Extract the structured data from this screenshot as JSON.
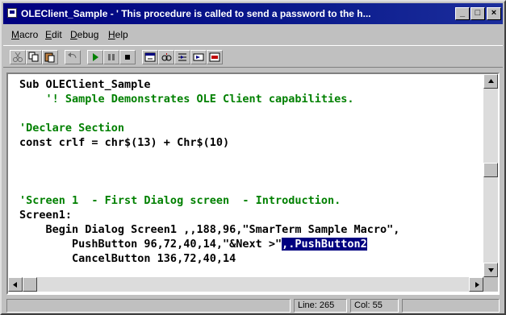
{
  "window": {
    "title": "OLEClient_Sample - ' This procedure is called to send a password to the h..."
  },
  "title_buttons": {
    "minimize": "_",
    "maximize": "□",
    "close": "×"
  },
  "menu": [
    {
      "first": "M",
      "rest": "acro"
    },
    {
      "first": "E",
      "rest": "dit"
    },
    {
      "first": "D",
      "rest": "ebug"
    },
    {
      "first": "H",
      "rest": "elp"
    }
  ],
  "toolbar": {
    "tools": [
      "cut-icon",
      "copy-icon",
      "paste-icon",
      "undo-icon",
      "run-icon",
      "pause-icon",
      "stop-icon",
      "dialog-editor-icon",
      "watch-icon",
      "step-into-icon",
      "step-over-icon",
      "toggle-breakpoint-icon"
    ]
  },
  "code": {
    "lines": [
      [
        {
          "t": "Sub OLEClient_Sample",
          "c": "kw"
        }
      ],
      [
        {
          "t": "    '! Sample Demonstrates OLE Client capabilities.",
          "c": "cm"
        }
      ],
      [
        {
          "t": "",
          "c": "kw"
        }
      ],
      [
        {
          "t": "'Declare Section",
          "c": "cm"
        }
      ],
      [
        {
          "t": "const crlf = chr$(13) + Chr$(10)",
          "c": "kw"
        }
      ],
      [
        {
          "t": "",
          "c": "kw"
        }
      ],
      [
        {
          "t": "",
          "c": "kw"
        }
      ],
      [
        {
          "t": "",
          "c": "kw"
        }
      ],
      [
        {
          "t": "'Screen 1  - First Dialog screen  - Introduction.",
          "c": "cm"
        }
      ],
      [
        {
          "t": "Screen1:",
          "c": "kw"
        }
      ],
      [
        {
          "t": "    Begin Dialog Screen1 ,,188,96,\"SmarTerm Sample Macro\",",
          "c": "kw"
        }
      ],
      [
        {
          "t": "        PushButton 96,72,40,14,\"&Next >\"",
          "c": "kw"
        },
        {
          "t": ",.PushButton2",
          "c": "sel"
        }
      ],
      [
        {
          "t": "        CancelButton 136,72,40,14",
          "c": "kw"
        }
      ]
    ]
  },
  "status": {
    "line": "Line: 265",
    "col": "Col: 55"
  }
}
